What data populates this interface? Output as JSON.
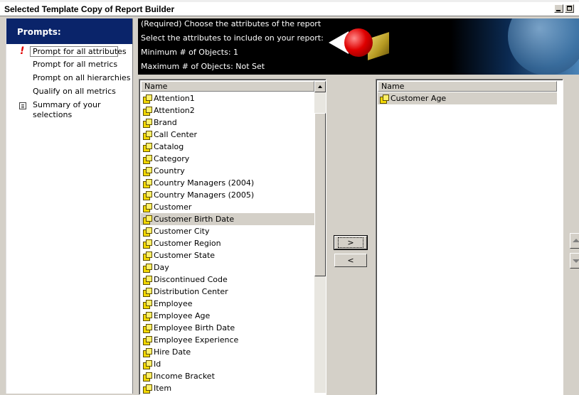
{
  "window": {
    "title": "Selected Template Copy of Report Builder"
  },
  "sidebar": {
    "header": "Prompts:",
    "required_mark": "!",
    "items": [
      {
        "label": "Prompt for all attributes",
        "selected": true
      },
      {
        "label": "Prompt for all metrics"
      },
      {
        "label": "Prompt on all hierarchies"
      },
      {
        "label": "Qualify on all metrics"
      },
      {
        "label": "Summary of your selections",
        "line1": "Summary of your",
        "line2": "selections"
      }
    ]
  },
  "banner": {
    "required_text": "(Required) Choose the attributes of the report",
    "instruction": "Select the attributes to include on your report:",
    "min_objects": "Minimum # of Objects: 1",
    "max_objects": "Maximum # of Objects: Not Set"
  },
  "available_list": {
    "column_header": "Name",
    "items": [
      "Attention1",
      "Attention2",
      "Brand",
      "Call Center",
      "Catalog",
      "Category",
      "Country",
      "Country Managers (2004)",
      "Country Managers (2005)",
      "Customer",
      "Customer Birth Date",
      "Customer City",
      "Customer Region",
      "Customer State",
      "Day",
      "Discontinued Code",
      "Distribution Center",
      "Employee",
      "Employee Age",
      "Employee Birth Date",
      "Employee Experience",
      "Hire Date",
      "Id",
      "Income Bracket",
      "Item"
    ],
    "selected_item": "Customer Birth Date"
  },
  "selected_list": {
    "column_header": "Name",
    "items": [
      "Customer Age"
    ]
  },
  "buttons": {
    "add_label": ">",
    "remove_label": "<"
  },
  "colors": {
    "header_bg": "#0a246a",
    "banner_bg": "#000000",
    "dialog_bg": "#d4d0c8"
  }
}
